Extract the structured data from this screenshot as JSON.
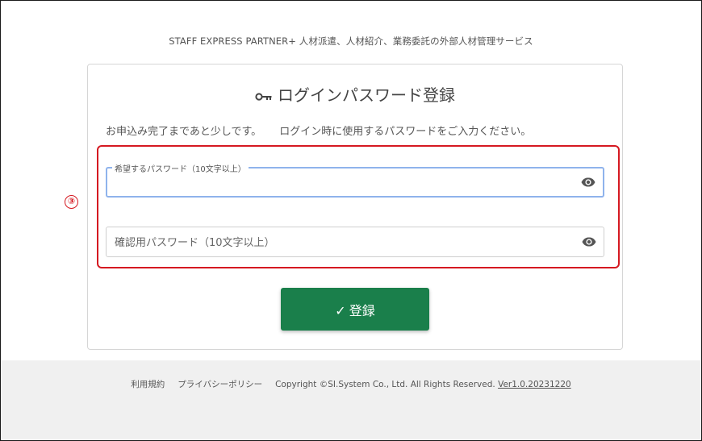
{
  "header": {
    "tagline": "STAFF EXPRESS PARTNER+ 人材派遣、人材紹介、業務委託の外部人材管理サービス"
  },
  "card": {
    "title": "ログインパスワード登録",
    "title_icon": "key-icon",
    "desc_1": "お申込み完了まであと少しです。",
    "desc_2": "ログイン時に使用するパスワードをご入力ください。"
  },
  "annotation": {
    "step_marker": "③",
    "highlight_color": "#d51921"
  },
  "form": {
    "password_label": "希望するパスワード（10文字以上）",
    "password_value": "",
    "confirm_placeholder": "確認用パスワード（10文字以上）",
    "confirm_value": "",
    "visibility_icon": "eye-icon",
    "submit_label": "登録",
    "submit_icon": "check-icon",
    "submit_color": "#1a7f4b"
  },
  "footer": {
    "terms": "利用規約",
    "privacy": "プライバシーポリシー",
    "copyright": "Copyright ©SI.System Co., Ltd. All Rights Reserved.",
    "version": "Ver1.0.20231220"
  }
}
